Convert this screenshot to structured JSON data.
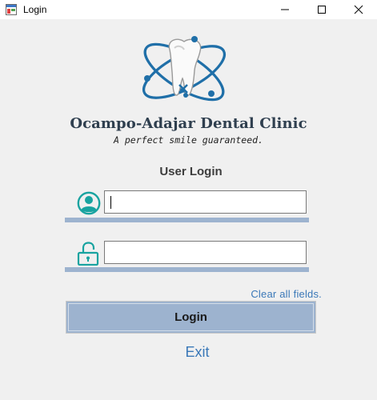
{
  "window": {
    "title": "Login",
    "controls": [
      "minimize-icon",
      "maximize-icon",
      "close-icon"
    ]
  },
  "branding": {
    "clinic_name": "Ocampo-Adajar Dental Clinic",
    "tagline": "A perfect smile guaranteed.",
    "logo": "tooth-atom-logo"
  },
  "form": {
    "heading": "User Login",
    "username": {
      "icon": "user-icon",
      "value": "",
      "placeholder": ""
    },
    "password": {
      "icon": "unlock-icon",
      "value": "",
      "placeholder": ""
    },
    "clear_label": "Clear all fields.",
    "login_label": "Login",
    "exit_label": "Exit"
  },
  "colors": {
    "accent_teal": "#18a3a0",
    "logo_blue": "#1f6fa8",
    "button_fill": "#9db3cf",
    "link_blue": "#3a78b8"
  }
}
